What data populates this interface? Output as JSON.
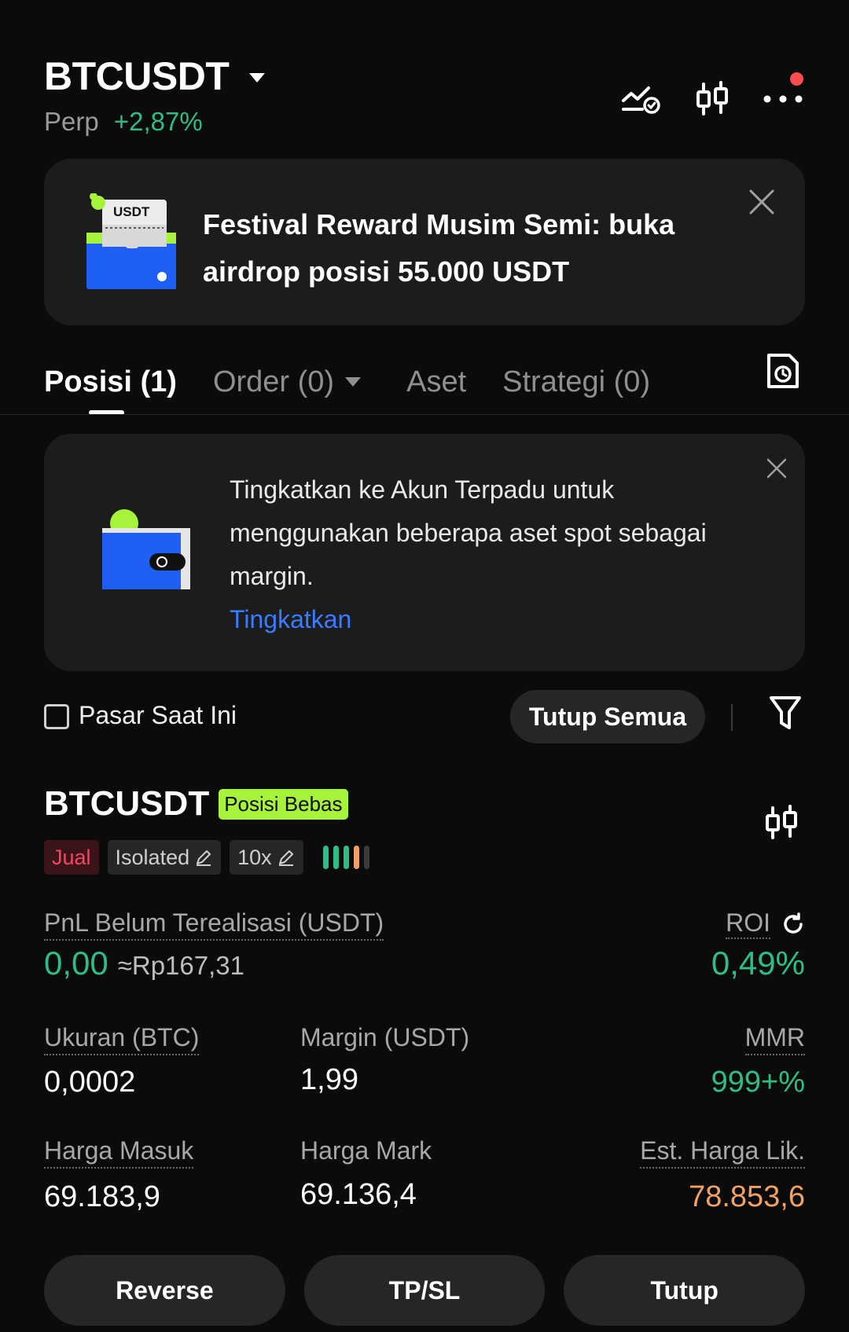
{
  "header": {
    "symbol": "BTCUSDT",
    "type": "Perp",
    "change": "+2,87%",
    "icons": [
      "price-alert-icon",
      "candlestick-chart-icon",
      "more-icon"
    ]
  },
  "banner": {
    "text": "Festival Reward Musim Semi: buka airdrop posisi 55.000 USDT",
    "illustration_label": "USDT"
  },
  "tabs": [
    {
      "label": "Posisi (1)",
      "active": true
    },
    {
      "label": "Order (0)",
      "active": false
    },
    {
      "label": "Aset",
      "active": false
    },
    {
      "label": "Strategi (0)",
      "active": false
    }
  ],
  "info_card": {
    "text": "Tingkatkan ke Akun Terpadu untuk menggunakan beberapa aset spot sebagai margin.",
    "link": "Tingkatkan"
  },
  "controls": {
    "checkbox_label": "Pasar Saat Ini",
    "close_all": "Tutup Semua"
  },
  "position": {
    "symbol": "BTCUSDT",
    "mode_tag": "Posisi Bebas",
    "side": "Jual",
    "margin_mode": "Isolated",
    "leverage": "10x",
    "pnl_label": "PnL Belum Terealisasi (USDT)",
    "pnl_value": "0,00",
    "pnl_approx": "≈Rp167,31",
    "roi_label": "ROI",
    "roi_value": "0,49%",
    "size_label": "Ukuran (BTC)",
    "size_value": "0,0002",
    "margin_label": "Margin (USDT)",
    "margin_value": "1,99",
    "mmr_label": "MMR",
    "mmr_value": "999+%",
    "entry_label": "Harga Masuk",
    "entry_value": "69.183,9",
    "mark_label": "Harga Mark",
    "mark_value": "69.136,4",
    "liq_label": "Est. Harga Lik.",
    "liq_value": "78.853,6"
  },
  "actions": {
    "reverse": "Reverse",
    "tpsl": "TP/SL",
    "close": "Tutup"
  },
  "colors": {
    "up": "#2ebd85",
    "down": "#f6465d",
    "liq": "#f0a264",
    "link": "#3a7bff",
    "tag": "#a6f33b"
  }
}
